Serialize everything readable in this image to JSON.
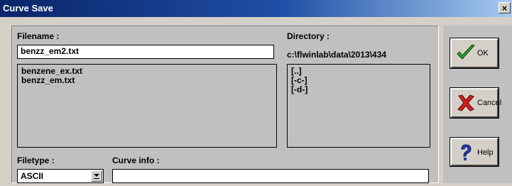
{
  "window": {
    "title": "Curve Save",
    "close_symbol": "×"
  },
  "filename": {
    "label": "Filename :",
    "value": "benzz_em2.txt"
  },
  "files": [
    "benzene_ex.txt",
    "benzz_em.txt"
  ],
  "directory": {
    "label": "Directory :",
    "path": "c:\\flwinlab\\data\\2013\\434",
    "entries": [
      "[..]",
      "[-c-]",
      "[-d-]"
    ]
  },
  "filetype": {
    "label": "Filetype :",
    "value": "ASCII"
  },
  "curve_info": {
    "label": "Curve info :",
    "value": ""
  },
  "buttons": {
    "ok": "OK",
    "cancel": "Cancel",
    "help": "Help"
  },
  "icons": {
    "ok": "checkmark-icon",
    "cancel": "x-icon",
    "help": "question-icon",
    "dropdown": "chevron-down-icon"
  },
  "colors": {
    "title_start": "#0a246a",
    "title_end": "#a6caf0",
    "ok_green": "#2e9e2e",
    "cancel_red": "#cc1f1f",
    "help_blue": "#1f3fb0"
  }
}
